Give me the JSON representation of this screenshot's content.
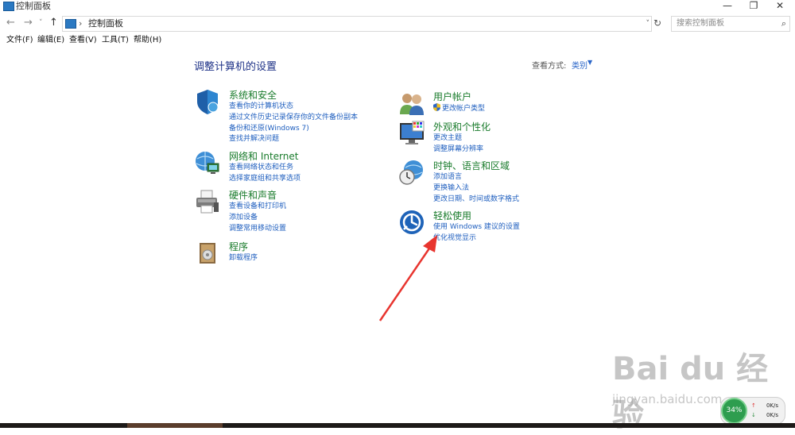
{
  "window": {
    "title": "控制面板",
    "buttons": [
      "—",
      "❐",
      "✕"
    ]
  },
  "nav": {
    "back": "←",
    "forward": "→",
    "dropdown": "˅",
    "up": "↑",
    "breadcrumb_sep": "›",
    "breadcrumb": "控制面板",
    "addr_dropdown": "˅",
    "refresh": "↻",
    "search_placeholder": "搜索控制面板",
    "search_icon": "⌕"
  },
  "menu": [
    "文件(F)",
    "编辑(E)",
    "查看(V)",
    "工具(T)",
    "帮助(H)"
  ],
  "content": {
    "heading": "调整计算机的设置",
    "view_by_label": "查看方式:",
    "view_by_value": "类别",
    "view_by_caret": "▼"
  },
  "categories": [
    {
      "title": "系统和安全",
      "icon": "shield-icon",
      "links": [
        "查看你的计算机状态",
        "通过文件历史记录保存你的文件备份副本",
        "备份和还原(Windows 7)",
        "查找并解决问题"
      ]
    },
    {
      "title": "网络和 Internet",
      "icon": "globe-network-icon",
      "links": [
        "查看网络状态和任务",
        "选择家庭组和共享选项"
      ]
    },
    {
      "title": "硬件和声音",
      "icon": "printer-icon",
      "links": [
        "查看设备和打印机",
        "添加设备",
        "调整常用移动设置"
      ]
    },
    {
      "title": "程序",
      "icon": "programs-icon",
      "links": [
        "卸载程序"
      ]
    },
    {
      "title": "用户帐户",
      "icon": "users-icon",
      "links": [
        "更改帐户类型"
      ]
    },
    {
      "title": "外观和个性化",
      "icon": "monitor-palette-icon",
      "links": [
        "更改主题",
        "调整屏幕分辨率"
      ]
    },
    {
      "title": "时钟、语言和区域",
      "icon": "clock-globe-icon",
      "links": [
        "添加语言",
        "更换输入法",
        "更改日期、时间或数字格式"
      ]
    },
    {
      "title": "轻松使用",
      "icon": "ease-of-access-icon",
      "links": [
        "使用 Windows 建议的设置",
        "优化视觉显示"
      ]
    }
  ],
  "widget": {
    "percent": "34%",
    "up_arrow": "↑",
    "down_arrow": "↓",
    "up_speed": "0K/s",
    "down_speed": "0K/s"
  },
  "watermark": {
    "text": "Bai du 经验",
    "url": "jingyan.baidu.com"
  },
  "colors": {
    "category_title": "#197b2b",
    "link": "#1f5fbf",
    "heading": "#1e3287",
    "annotation_arrow": "#e8352f"
  }
}
